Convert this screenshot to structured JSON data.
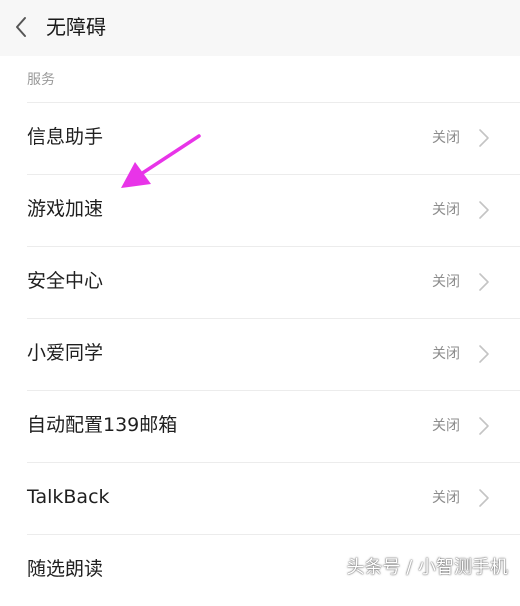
{
  "header": {
    "title": "无障碍",
    "back_icon": "chevron-left-icon"
  },
  "section": {
    "label": "服务"
  },
  "items": [
    {
      "label": "信息助手",
      "status": "关闭"
    },
    {
      "label": "游戏加速",
      "status": "关闭"
    },
    {
      "label": "安全中心",
      "status": "关闭"
    },
    {
      "label": "小爱同学",
      "status": "关闭"
    },
    {
      "label": "自动配置139邮箱",
      "status": "关闭"
    },
    {
      "label": "TalkBack",
      "status": "关闭"
    },
    {
      "label": "随选朗读",
      "status": ""
    }
  ],
  "annotation": {
    "arrow_color": "#e834e8"
  },
  "watermark": {
    "text": "头条号 / 小智测手机"
  },
  "colors": {
    "header_bg": "#f7f7f7",
    "divider": "#ececec",
    "status_text": "#8c8c8c",
    "chevron": "#c4c4c4"
  }
}
